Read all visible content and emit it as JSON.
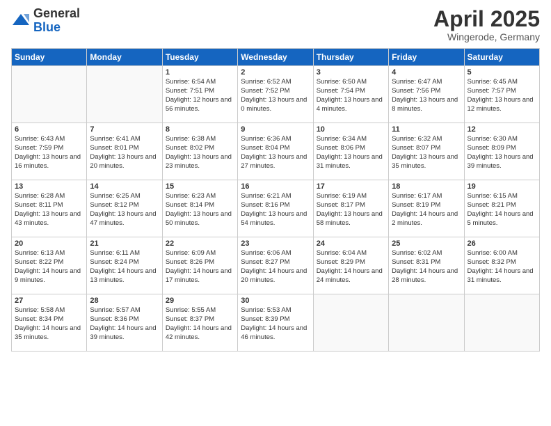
{
  "logo": {
    "general": "General",
    "blue": "Blue"
  },
  "title": "April 2025",
  "location": "Wingerode, Germany",
  "days_of_week": [
    "Sunday",
    "Monday",
    "Tuesday",
    "Wednesday",
    "Thursday",
    "Friday",
    "Saturday"
  ],
  "weeks": [
    [
      {
        "day": "",
        "empty": true
      },
      {
        "day": "",
        "empty": true
      },
      {
        "day": "1",
        "sunrise": "Sunrise: 6:54 AM",
        "sunset": "Sunset: 7:51 PM",
        "daylight": "Daylight: 12 hours and 56 minutes."
      },
      {
        "day": "2",
        "sunrise": "Sunrise: 6:52 AM",
        "sunset": "Sunset: 7:52 PM",
        "daylight": "Daylight: 13 hours and 0 minutes."
      },
      {
        "day": "3",
        "sunrise": "Sunrise: 6:50 AM",
        "sunset": "Sunset: 7:54 PM",
        "daylight": "Daylight: 13 hours and 4 minutes."
      },
      {
        "day": "4",
        "sunrise": "Sunrise: 6:47 AM",
        "sunset": "Sunset: 7:56 PM",
        "daylight": "Daylight: 13 hours and 8 minutes."
      },
      {
        "day": "5",
        "sunrise": "Sunrise: 6:45 AM",
        "sunset": "Sunset: 7:57 PM",
        "daylight": "Daylight: 13 hours and 12 minutes."
      }
    ],
    [
      {
        "day": "6",
        "sunrise": "Sunrise: 6:43 AM",
        "sunset": "Sunset: 7:59 PM",
        "daylight": "Daylight: 13 hours and 16 minutes."
      },
      {
        "day": "7",
        "sunrise": "Sunrise: 6:41 AM",
        "sunset": "Sunset: 8:01 PM",
        "daylight": "Daylight: 13 hours and 20 minutes."
      },
      {
        "day": "8",
        "sunrise": "Sunrise: 6:38 AM",
        "sunset": "Sunset: 8:02 PM",
        "daylight": "Daylight: 13 hours and 23 minutes."
      },
      {
        "day": "9",
        "sunrise": "Sunrise: 6:36 AM",
        "sunset": "Sunset: 8:04 PM",
        "daylight": "Daylight: 13 hours and 27 minutes."
      },
      {
        "day": "10",
        "sunrise": "Sunrise: 6:34 AM",
        "sunset": "Sunset: 8:06 PM",
        "daylight": "Daylight: 13 hours and 31 minutes."
      },
      {
        "day": "11",
        "sunrise": "Sunrise: 6:32 AM",
        "sunset": "Sunset: 8:07 PM",
        "daylight": "Daylight: 13 hours and 35 minutes."
      },
      {
        "day": "12",
        "sunrise": "Sunrise: 6:30 AM",
        "sunset": "Sunset: 8:09 PM",
        "daylight": "Daylight: 13 hours and 39 minutes."
      }
    ],
    [
      {
        "day": "13",
        "sunrise": "Sunrise: 6:28 AM",
        "sunset": "Sunset: 8:11 PM",
        "daylight": "Daylight: 13 hours and 43 minutes."
      },
      {
        "day": "14",
        "sunrise": "Sunrise: 6:25 AM",
        "sunset": "Sunset: 8:12 PM",
        "daylight": "Daylight: 13 hours and 47 minutes."
      },
      {
        "day": "15",
        "sunrise": "Sunrise: 6:23 AM",
        "sunset": "Sunset: 8:14 PM",
        "daylight": "Daylight: 13 hours and 50 minutes."
      },
      {
        "day": "16",
        "sunrise": "Sunrise: 6:21 AM",
        "sunset": "Sunset: 8:16 PM",
        "daylight": "Daylight: 13 hours and 54 minutes."
      },
      {
        "day": "17",
        "sunrise": "Sunrise: 6:19 AM",
        "sunset": "Sunset: 8:17 PM",
        "daylight": "Daylight: 13 hours and 58 minutes."
      },
      {
        "day": "18",
        "sunrise": "Sunrise: 6:17 AM",
        "sunset": "Sunset: 8:19 PM",
        "daylight": "Daylight: 14 hours and 2 minutes."
      },
      {
        "day": "19",
        "sunrise": "Sunrise: 6:15 AM",
        "sunset": "Sunset: 8:21 PM",
        "daylight": "Daylight: 14 hours and 5 minutes."
      }
    ],
    [
      {
        "day": "20",
        "sunrise": "Sunrise: 6:13 AM",
        "sunset": "Sunset: 8:22 PM",
        "daylight": "Daylight: 14 hours and 9 minutes."
      },
      {
        "day": "21",
        "sunrise": "Sunrise: 6:11 AM",
        "sunset": "Sunset: 8:24 PM",
        "daylight": "Daylight: 14 hours and 13 minutes."
      },
      {
        "day": "22",
        "sunrise": "Sunrise: 6:09 AM",
        "sunset": "Sunset: 8:26 PM",
        "daylight": "Daylight: 14 hours and 17 minutes."
      },
      {
        "day": "23",
        "sunrise": "Sunrise: 6:06 AM",
        "sunset": "Sunset: 8:27 PM",
        "daylight": "Daylight: 14 hours and 20 minutes."
      },
      {
        "day": "24",
        "sunrise": "Sunrise: 6:04 AM",
        "sunset": "Sunset: 8:29 PM",
        "daylight": "Daylight: 14 hours and 24 minutes."
      },
      {
        "day": "25",
        "sunrise": "Sunrise: 6:02 AM",
        "sunset": "Sunset: 8:31 PM",
        "daylight": "Daylight: 14 hours and 28 minutes."
      },
      {
        "day": "26",
        "sunrise": "Sunrise: 6:00 AM",
        "sunset": "Sunset: 8:32 PM",
        "daylight": "Daylight: 14 hours and 31 minutes."
      }
    ],
    [
      {
        "day": "27",
        "sunrise": "Sunrise: 5:58 AM",
        "sunset": "Sunset: 8:34 PM",
        "daylight": "Daylight: 14 hours and 35 minutes."
      },
      {
        "day": "28",
        "sunrise": "Sunrise: 5:57 AM",
        "sunset": "Sunset: 8:36 PM",
        "daylight": "Daylight: 14 hours and 39 minutes."
      },
      {
        "day": "29",
        "sunrise": "Sunrise: 5:55 AM",
        "sunset": "Sunset: 8:37 PM",
        "daylight": "Daylight: 14 hours and 42 minutes."
      },
      {
        "day": "30",
        "sunrise": "Sunrise: 5:53 AM",
        "sunset": "Sunset: 8:39 PM",
        "daylight": "Daylight: 14 hours and 46 minutes."
      },
      {
        "day": "",
        "empty": true
      },
      {
        "day": "",
        "empty": true
      },
      {
        "day": "",
        "empty": true
      }
    ]
  ]
}
